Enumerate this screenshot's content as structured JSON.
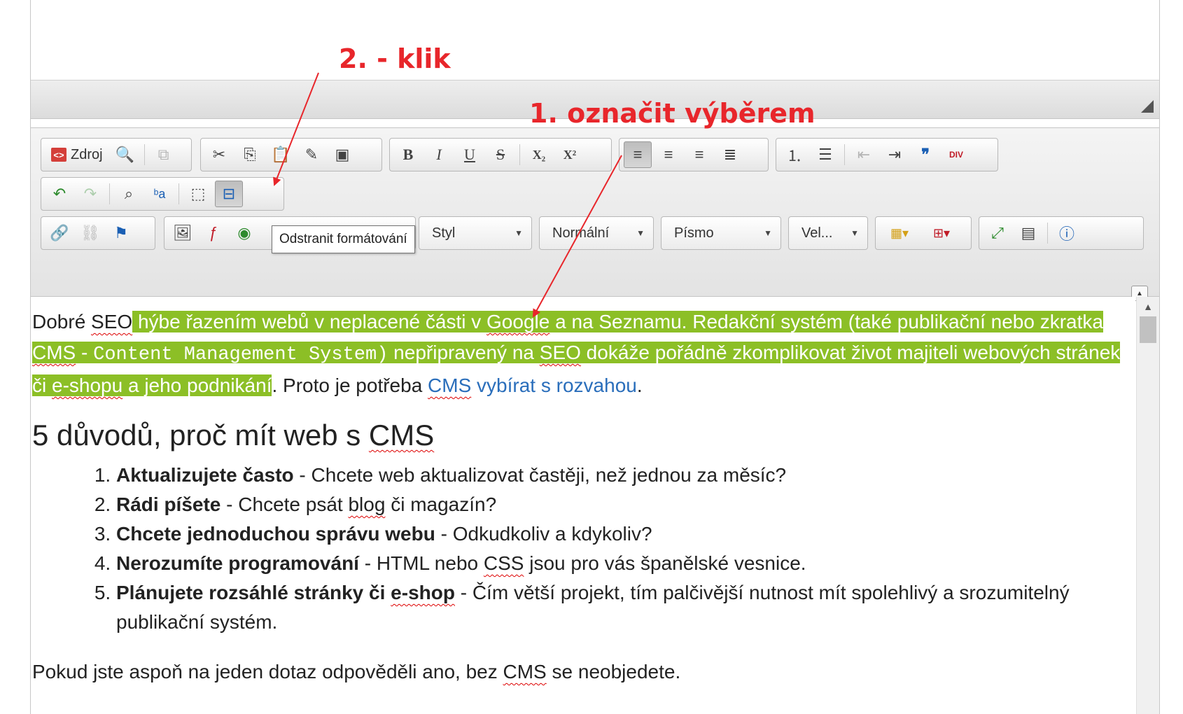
{
  "annotations": {
    "step1": "1. označit výběrem",
    "step2": "2. - klik"
  },
  "toolbar": {
    "row1": {
      "source_label": "Zdroj",
      "buttons": [
        "preview-icon",
        "templates-icon",
        "cut-icon",
        "copy-icon",
        "paste-icon",
        "paste-text-icon",
        "paste-word-icon",
        "bold-icon",
        "italic-icon",
        "underline-icon",
        "strikethrough-icon",
        "subscript-icon",
        "superscript-icon",
        "align-left-icon",
        "align-center-icon",
        "align-right-icon",
        "align-justify-icon",
        "numbered-list-icon",
        "bulleted-list-icon",
        "outdent-icon",
        "indent-icon",
        "blockquote-icon",
        "div-container-icon"
      ],
      "glyphs": {
        "bold": "B",
        "italic": "I",
        "underline": "U",
        "strike": "S",
        "sub": "X₂",
        "sup": "X²",
        "quote": "❞",
        "div": "DIV"
      }
    },
    "row2": {
      "buttons": [
        "undo-icon",
        "redo-icon",
        "find-icon",
        "replace-icon",
        "select-all-icon",
        "remove-format-icon"
      ]
    },
    "row3": {
      "buttons": [
        "link-icon",
        "unlink-icon",
        "anchor-icon",
        "image-icon",
        "flash-icon",
        "iframe-icon",
        "table-icon",
        "maximize-icon",
        "show-blocks-icon",
        "about-icon"
      ],
      "combos": {
        "style": "Styl",
        "format": "Normální",
        "font": "Písmo",
        "size": "Vel..."
      }
    },
    "tooltip": "Odstranit formátování"
  },
  "content": {
    "para1_before": "Dobré ",
    "para1_seo": "SEO",
    "para1_sel1": " hýbe řazením webů v neplacené části v ",
    "para1_google": "Google",
    "para1_sel2": " a na Seznamu. Redakční systém (také publikační nebo zkratka ",
    "para1_cms1": "CMS",
    "para1_dash": " - ",
    "para1_mono": "Content Management System)",
    "para1_sel3": " nepřipravený na ",
    "para1_seo2": "SEO",
    "para1_sel4": " dokáže pořádně zkomplikovat život majiteli webových stránek či ",
    "para1_eshop": "e-shopu",
    "para1_sel5": " a jeho podnikání",
    "para1_after": ". Proto je potřeba ",
    "para1_link_cms": "CMS",
    "para1_link_rest": " vybírat s rozvahou",
    "para1_end": ".",
    "heading_main": "5 důvodů, proč mít web s ",
    "heading_cms": "CMS",
    "list": [
      {
        "bold": "Aktualizujete často",
        "text": " - Chcete web aktualizovat častěji, než jednou za měsíc?"
      },
      {
        "bold": "Rádi píšete",
        "text_a": " - Chcete psát ",
        "spell": "blog",
        "text_b": " či magazín?"
      },
      {
        "bold": "Chcete jednoduchou správu webu",
        "text": " - Odkudkoliv a kdykoliv?"
      },
      {
        "bold": "Nerozumíte programování",
        "text_a": " - HTML nebo ",
        "spell": "CSS",
        "text_b": " jsou pro vás španělské vesnice."
      },
      {
        "bold_a": "Plánujete rozsáhlé stránky či ",
        "bold_spell": "e-shop",
        "text": " - Čím větší projekt, tím palčivější nutnost mít spolehlivý a srozumitelný publikační systém."
      }
    ],
    "closing_a": "Pokud jste aspoň na jeden dotaz odpověděli ano, bez ",
    "closing_cms": "CMS",
    "closing_b": " se neobjedete."
  }
}
